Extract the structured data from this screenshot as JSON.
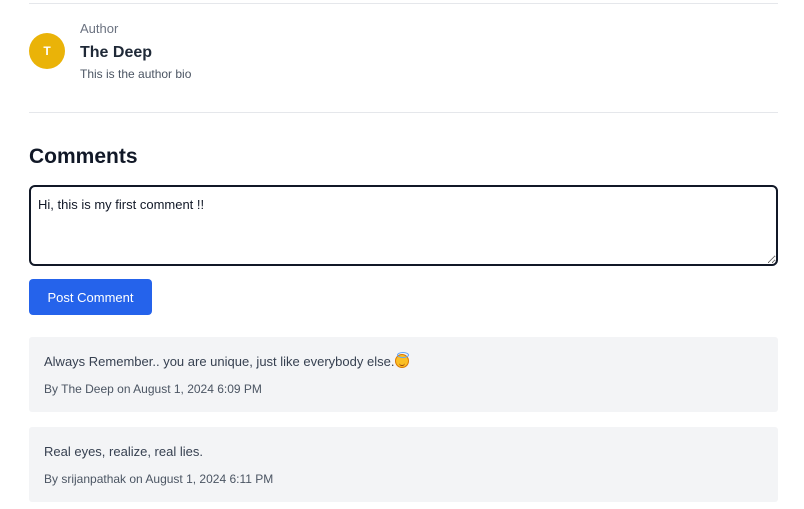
{
  "author": {
    "caption": "Author",
    "initial": "T",
    "name": "The Deep",
    "bio": "This is the author bio",
    "avatar_color": "#eab308"
  },
  "comments_section": {
    "title": "Comments",
    "input_value": "Hi, this is my first comment !!",
    "post_button_label": "Post Comment",
    "button_color": "#2563eb"
  },
  "comments": [
    {
      "text": "Always Remember.. you are unique, just like everybody else.",
      "emoji": "smiling-face-with-halo",
      "meta": "By The Deep on August 1, 2024 6:09 PM"
    },
    {
      "text": "Real eyes, realize, real lies.",
      "meta": "By srijanpathak on August 1, 2024 6:11 PM"
    }
  ]
}
